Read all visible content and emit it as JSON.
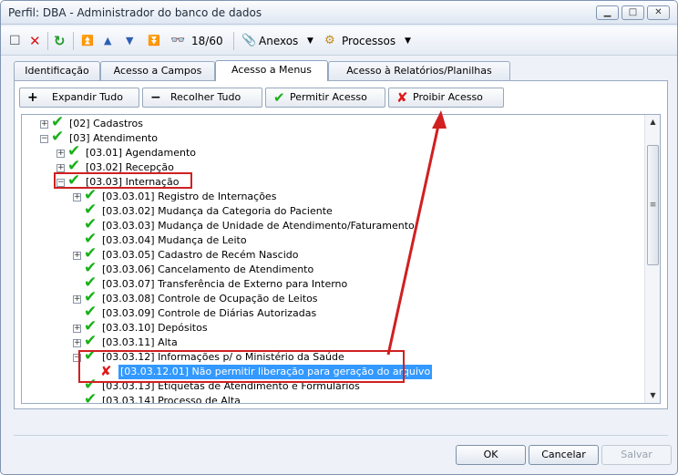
{
  "window": {
    "title": "Perfil: DBA - Administrador do banco de dados"
  },
  "toolbar": {
    "record_counter": "18/60",
    "attachments_label": "Anexos",
    "processes_label": "Processos"
  },
  "tabs": [
    {
      "label": "Identificação"
    },
    {
      "label": "Acesso a Campos"
    },
    {
      "label": "Acesso a Menus"
    },
    {
      "label": "Acesso à Relatórios/Planilhas"
    }
  ],
  "actions": {
    "expand_all": "Expandir Tudo",
    "collapse_all": "Recolher Tudo",
    "allow_access": "Permitir Acesso",
    "deny_access": "Proibir Acesso"
  },
  "tree": {
    "items": [
      {
        "label": "[02] Cadastros",
        "expander": "+",
        "mark": "✔"
      },
      {
        "label": "[03] Atendimento",
        "expander": "−",
        "mark": "✔"
      },
      {
        "label": "[03.01] Agendamento",
        "expander": "+",
        "mark": "✔"
      },
      {
        "label": "[03.02] Recepção",
        "expander": "+",
        "mark": "✔"
      },
      {
        "label": "[03.03] Internação",
        "expander": "−",
        "mark": "✔"
      },
      {
        "label": "[03.03.01] Registro de Internações",
        "expander": "+",
        "mark": "✔"
      },
      {
        "label": "[03.03.02] Mudança da Categoria do Paciente",
        "expander": "",
        "mark": "✔"
      },
      {
        "label": "[03.03.03] Mudança de Unidade de Atendimento/Faturamento",
        "expander": "",
        "mark": "✔"
      },
      {
        "label": "[03.03.04] Mudança de Leito",
        "expander": "",
        "mark": "✔"
      },
      {
        "label": "[03.03.05] Cadastro de Recém Nascido",
        "expander": "+",
        "mark": "✔"
      },
      {
        "label": "[03.03.06] Cancelamento de Atendimento",
        "expander": "",
        "mark": "✔"
      },
      {
        "label": "[03.03.07] Transferência de Externo para Interno",
        "expander": "",
        "mark": "✔"
      },
      {
        "label": "[03.03.08] Controle de Ocupação de Leitos",
        "expander": "+",
        "mark": "✔"
      },
      {
        "label": "[03.03.09] Controle de Diárias Autorizadas",
        "expander": "",
        "mark": "✔"
      },
      {
        "label": "[03.03.10] Depósitos",
        "expander": "+",
        "mark": "✔"
      },
      {
        "label": "[03.03.11] Alta",
        "expander": "+",
        "mark": "✔"
      },
      {
        "label": "[03.03.12] Informações p/ o Ministério da Saúde",
        "expander": "−",
        "mark": "✔"
      },
      {
        "label": "[03.03.12.01] Não permitir liberação para geração do arquivo",
        "expander": "",
        "mark": "✘"
      },
      {
        "label": "[03.03.13] Etiquetas de Atendimento e Formulários",
        "expander": "",
        "mark": "✔"
      },
      {
        "label": "[03.03.14] Processo de Alta",
        "expander": "",
        "mark": "✔"
      }
    ]
  },
  "dialog": {
    "ok": "OK",
    "cancel": "Cancelar",
    "save": "Salvar"
  },
  "colors": {
    "allowed": "#18b018",
    "denied": "#e01818",
    "highlight": "#d02020",
    "selection": "#3399ff"
  },
  "icons": [
    "new-icon",
    "delete-icon",
    "refresh-icon",
    "first-icon",
    "previous-icon",
    "next-icon",
    "last-icon",
    "binoculars-icon",
    "paperclip-icon",
    "gears-icon"
  ]
}
